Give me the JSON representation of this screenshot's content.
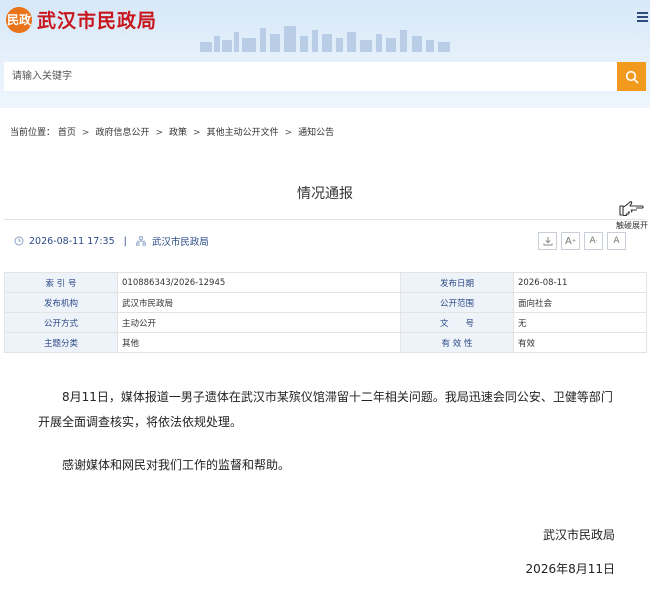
{
  "header": {
    "logo_emblem": "民政",
    "logo_text": "武汉市民政局",
    "menu_icon": "hamburger-menu-icon"
  },
  "search": {
    "placeholder": "请输入关键字",
    "button_icon": "search-icon"
  },
  "breadcrumb": {
    "label": "当前位置：",
    "items": [
      "首页",
      "政府信息公开",
      "政策",
      "其他主动公开文件",
      "通知公告"
    ]
  },
  "article": {
    "title": "情况通报",
    "touch_expand_label": "触碰展开",
    "datetime": "2026-08-11 17:35",
    "source": "武汉市民政局",
    "tools": {
      "download_icon": "download-icon",
      "font_large": "A",
      "font_medium": "A",
      "font_small": "A"
    }
  },
  "info_table": {
    "rows": [
      {
        "k1": "索 引 号",
        "v1": "010886343/2026-12945",
        "k2": "发布日期",
        "v2": "2026-08-11"
      },
      {
        "k1": "发布机构",
        "v1": "武汉市民政局",
        "k2": "公开范围",
        "v2": "面向社会"
      },
      {
        "k1": "公开方式",
        "v1": "主动公开",
        "k2": "文　　号",
        "v2": "无"
      },
      {
        "k1": "主题分类",
        "v1": "其他",
        "k2": "有 效 性",
        "v2": "有效"
      }
    ]
  },
  "body": {
    "p1": "8月11日，媒体报道一男子遗体在武汉市某殡仪馆滞留十二年相关问题。我局迅速会同公安、卫健等部门开展全面调查核实，将依法依规处理。",
    "p2": "感谢媒体和网民对我们工作的监督和帮助。",
    "signature": "武汉市民政局",
    "date": "2026年8月11日"
  },
  "colors": {
    "brand_red": "#c8161d",
    "accent_orange": "#f29a1d",
    "link_blue": "#2b4a86"
  }
}
